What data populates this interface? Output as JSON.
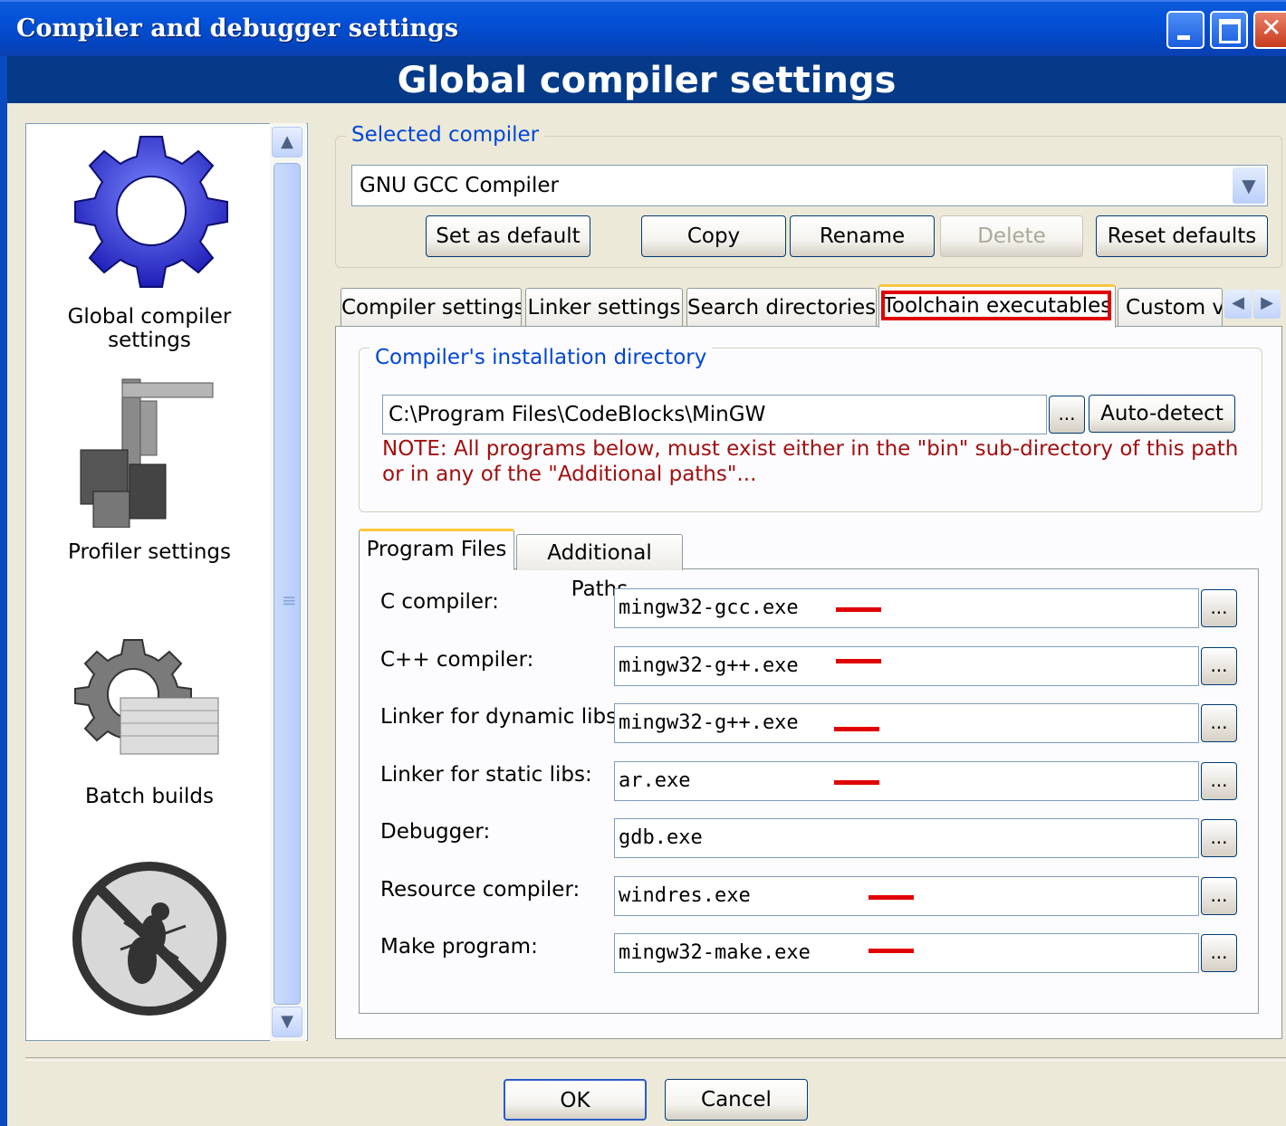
{
  "window": {
    "title": "Compiler and debugger settings"
  },
  "header": {
    "title": "Global compiler settings"
  },
  "sidebar": {
    "items": [
      {
        "label": "Global compiler settings",
        "icon": "gear-icon"
      },
      {
        "label": "Profiler settings",
        "icon": "caliper-icon"
      },
      {
        "label": "Batch builds",
        "icon": "batch-gear-icon"
      },
      {
        "label": "",
        "icon": "no-bug-icon"
      }
    ]
  },
  "selected_compiler": {
    "group_label": "Selected compiler",
    "value": "GNU GCC Compiler",
    "buttons": {
      "set_default": "Set as default",
      "copy": "Copy",
      "rename": "Rename",
      "delete": "Delete",
      "reset": "Reset defaults"
    }
  },
  "tabs": [
    "Compiler settings",
    "Linker settings",
    "Search directories",
    "Toolchain executables",
    "Custom va"
  ],
  "install_dir": {
    "group_label": "Compiler's installation directory",
    "path": "C:\\Program Files\\CodeBlocks\\MinGW",
    "browse": "...",
    "autodetect": "Auto-detect",
    "note_line1": "NOTE: All programs below, must exist either in the \"bin\" sub-directory of this path",
    "note_line2": "or in any of the \"Additional paths\"..."
  },
  "subtabs": [
    "Program Files",
    "Additional Paths"
  ],
  "programs": [
    {
      "label": "C compiler:",
      "value": "mingw32-gcc.exe"
    },
    {
      "label": "C++ compiler:",
      "value": "mingw32-g++.exe"
    },
    {
      "label": "Linker for dynamic libs:",
      "value": "mingw32-g++.exe"
    },
    {
      "label": "Linker for static libs:",
      "value": "ar.exe"
    },
    {
      "label": "Debugger:",
      "value": "gdb.exe"
    },
    {
      "label": "Resource compiler:",
      "value": "windres.exe"
    },
    {
      "label": "Make program:",
      "value": "mingw32-make.exe"
    }
  ],
  "ellipsis": "...",
  "footer": {
    "ok": "OK",
    "cancel": "Cancel"
  },
  "colors": {
    "title_bar": "#0451d8",
    "header": "#043a87",
    "highlight": "#e00000",
    "group_label": "#0046d5"
  }
}
